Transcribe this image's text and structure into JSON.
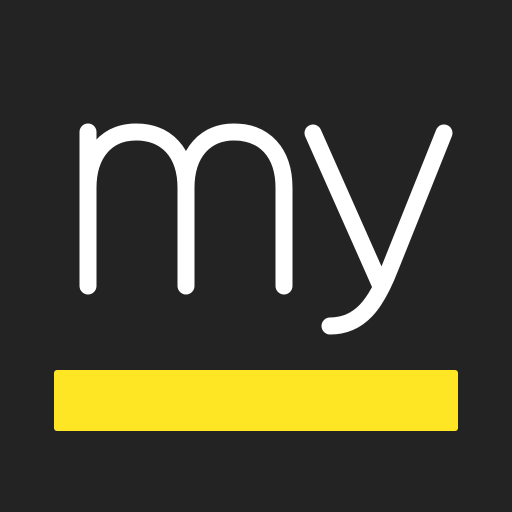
{
  "logo": {
    "wordmark": "my",
    "colors": {
      "background": "#232323",
      "text": "#ffffff",
      "bar": "#ffe625"
    }
  }
}
